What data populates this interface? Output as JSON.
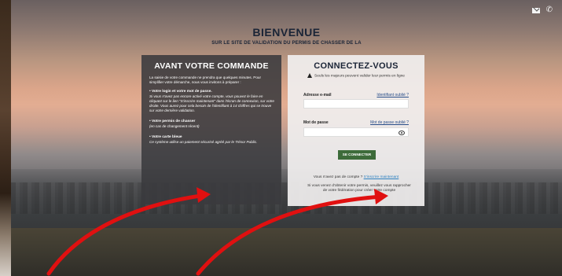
{
  "header": {
    "title": "BIENVENUE",
    "subtitle": "SUR LE SITE DE VALIDATION DU PERMIS DE CHASSER DE LA"
  },
  "top_icons": [
    "mail-icon",
    "phone-icon"
  ],
  "left_panel": {
    "heading": "AVANT VOTRE COMMANDE",
    "intro": "La saisie de votre commande ne prendra que quelques minutes. Pour simplifier votre démarche, nous vous invitons à préparer :",
    "items": [
      {
        "title": "• Votre login et votre mot de passe.",
        "detail": "Si vous n'avez pas encore activé votre compte, vous pouvez le faire en cliquant sur le lien \"S'inscrire maintenant\" dans l'écran de connexion, sur votre droite. Vous aurez pour cela besoin de l'identifiant à 14 chiffres qui se trouve sur votre dernière validation."
      },
      {
        "title": "• Votre permis de chasser",
        "detail": "(en cas de changement récent)"
      },
      {
        "title": "• Votre carte bleue",
        "detail": "Ce système utilise un paiement sécurisé agréé par le Trésor Public."
      }
    ]
  },
  "login": {
    "heading": "CONNECTEZ-VOUS",
    "warning": "Seuls les majeurs peuvent valider leur permis en ligne",
    "email_label": "Adresse e-mail",
    "email_forgot": "Identifiant oublié ?",
    "email_value": "",
    "password_label": "Mot de passe",
    "password_forgot": "Mot de passe oublié ?",
    "password_value": "",
    "submit": "SE CONNECTER",
    "no_account": "Vous n'avez pas de compte ?",
    "register_link": "S'inscrire maintenant",
    "info": "Si vous venez d'obtenir votre permis, veuillez vous rapprocher de votre fédération pour créer votre compte"
  },
  "colors": {
    "button": "#3d6b3a",
    "panel_dark": "#3a3a3e",
    "heading": "#1a2436",
    "link": "#2a7fc0",
    "arrow": "#e01010"
  }
}
